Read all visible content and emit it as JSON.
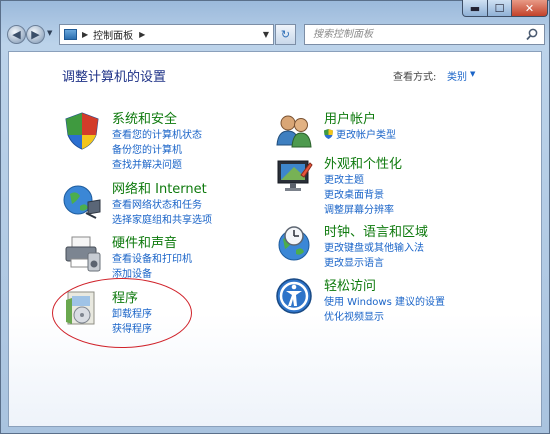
{
  "window": {
    "controls": {
      "minimize": "▬",
      "maximize": "☐",
      "close": "✕"
    }
  },
  "toolbar": {
    "back": "◀",
    "forward": "▶",
    "history_dropdown": "▼",
    "address": {
      "separator": "▶",
      "path": "控制面板",
      "separator_after": "▶",
      "dropdown": "▼"
    },
    "refresh": "↻",
    "search": {
      "placeholder": "搜索控制面板"
    }
  },
  "main": {
    "title": "调整计算机的设置",
    "view_by": {
      "label": "查看方式:",
      "value": "类别"
    },
    "categories": [
      {
        "title": "系统和安全",
        "icon": "shield-icon",
        "links": [
          "查看您的计算机状态",
          "备份您的计算机",
          "查找并解决问题"
        ]
      },
      {
        "title": "网络和 Internet",
        "icon": "network-globe-icon",
        "links": [
          "查看网络状态和任务",
          "选择家庭组和共享选项"
        ]
      },
      {
        "title": "硬件和声音",
        "icon": "printer-icon",
        "links": [
          "查看设备和打印机",
          "添加设备"
        ]
      },
      {
        "title": "程序",
        "icon": "programs-icon",
        "links": [
          "卸载程序",
          "获得程序"
        ]
      },
      {
        "title": "用户帐户",
        "icon": "users-icon",
        "links": [
          "更改帐户类型"
        ]
      },
      {
        "title": "外观和个性化",
        "icon": "monitor-icon",
        "links": [
          "更改主题",
          "更改桌面背景",
          "调整屏幕分辨率"
        ]
      },
      {
        "title": "时钟、语言和区域",
        "icon": "clock-globe-icon",
        "links": [
          "更改键盘或其他输入法",
          "更改显示语言"
        ]
      },
      {
        "title": "轻松访问",
        "icon": "ease-of-access-icon",
        "links": [
          "使用 Windows 建议的设置",
          "优化视频显示"
        ]
      }
    ]
  },
  "colors": {
    "title_green": "#0e7a0d",
    "link_blue": "#1a64c8",
    "highlight_red": "#d0222a"
  }
}
